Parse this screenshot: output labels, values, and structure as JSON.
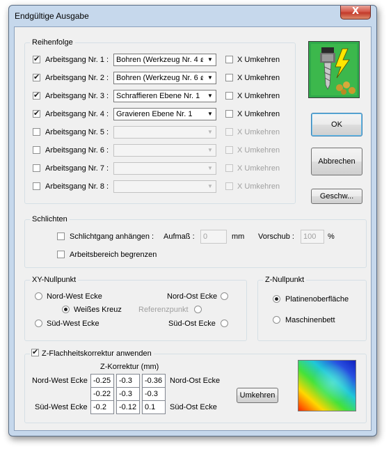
{
  "window": {
    "title": "Endgültige Ausgabe",
    "close_label": "X"
  },
  "reihenfolge": {
    "legend": "Reihenfolge",
    "items": [
      {
        "label": "Arbeitsgang Nr. 1 :",
        "checked": true,
        "value": "Bohren (Werkzeug Nr. 4 ø",
        "reverse": "X Umkehren",
        "enabled": true
      },
      {
        "label": "Arbeitsgang Nr. 2 :",
        "checked": true,
        "value": "Bohren (Werkzeug Nr. 6 ø",
        "reverse": "X Umkehren",
        "enabled": true
      },
      {
        "label": "Arbeitsgang Nr. 3 :",
        "checked": true,
        "value": "Schraffieren Ebene Nr. 1",
        "reverse": "X Umkehren",
        "enabled": true
      },
      {
        "label": "Arbeitsgang Nr. 4 :",
        "checked": true,
        "value": "Gravieren Ebene Nr. 1",
        "reverse": "X Umkehren",
        "enabled": true
      },
      {
        "label": "Arbeitsgang Nr. 5 :",
        "checked": false,
        "value": "",
        "reverse": "X Umkehren",
        "enabled": false
      },
      {
        "label": "Arbeitsgang Nr. 6 :",
        "checked": false,
        "value": "",
        "reverse": "X Umkehren",
        "enabled": false
      },
      {
        "label": "Arbeitsgang Nr. 7 :",
        "checked": false,
        "value": "",
        "reverse": "X Umkehren",
        "enabled": false
      },
      {
        "label": "Arbeitsgang Nr. 8 :",
        "checked": false,
        "value": "",
        "reverse": "X Umkehren",
        "enabled": false
      }
    ]
  },
  "buttons": {
    "ok": "OK",
    "cancel": "Abbrechen",
    "speed": "Geschw..."
  },
  "schlichten": {
    "legend": "Schlichten",
    "finish_pass": "Schlichtgang anhängen :",
    "allowance_label": "Aufmaß :",
    "allowance_value": "0",
    "allowance_unit": "mm",
    "feed_label": "Vorschub :",
    "feed_value": "100",
    "feed_unit": "%",
    "limit_area": "Arbeitsbereich begrenzen"
  },
  "xy_nullpunkt": {
    "legend": "XY-Nullpunkt",
    "nw": "Nord-West Ecke",
    "no": "Nord-Ost Ecke",
    "cross": "Weißes Kreuz",
    "ref": "Referenzpunkt",
    "sw": "Süd-West Ecke",
    "so": "Süd-Ost Ecke",
    "selected": "cross"
  },
  "z_nullpunkt": {
    "legend": "Z-Nullpunkt",
    "surface": "Platinenoberfläche",
    "bed": "Maschinenbett",
    "selected": "surface"
  },
  "flatness": {
    "legend": "Z-Flachheitskorrektur anwenden",
    "checked": true,
    "header": "Z-Korrektur (mm)",
    "nw": "Nord-West Ecke",
    "no": "Nord-Ost Ecke",
    "sw": "Süd-West Ecke",
    "so": "Süd-Ost Ecke",
    "rows": [
      [
        "-0.25",
        "-0.3",
        "-0.36"
      ],
      [
        "-0.22",
        "-0.3",
        "-0.3"
      ],
      [
        "-0.2",
        "-0.12",
        "0.1"
      ]
    ],
    "reverse_button": "Umkehren"
  },
  "colors": {
    "accent": "#3c7fb1",
    "title_bar": "#c6d8ec",
    "close": "#c33a2b"
  },
  "icons": [
    "close-icon",
    "cnc-drill-icon",
    "dropdown-arrow-icon",
    "flatness-heatmap-icon"
  ]
}
